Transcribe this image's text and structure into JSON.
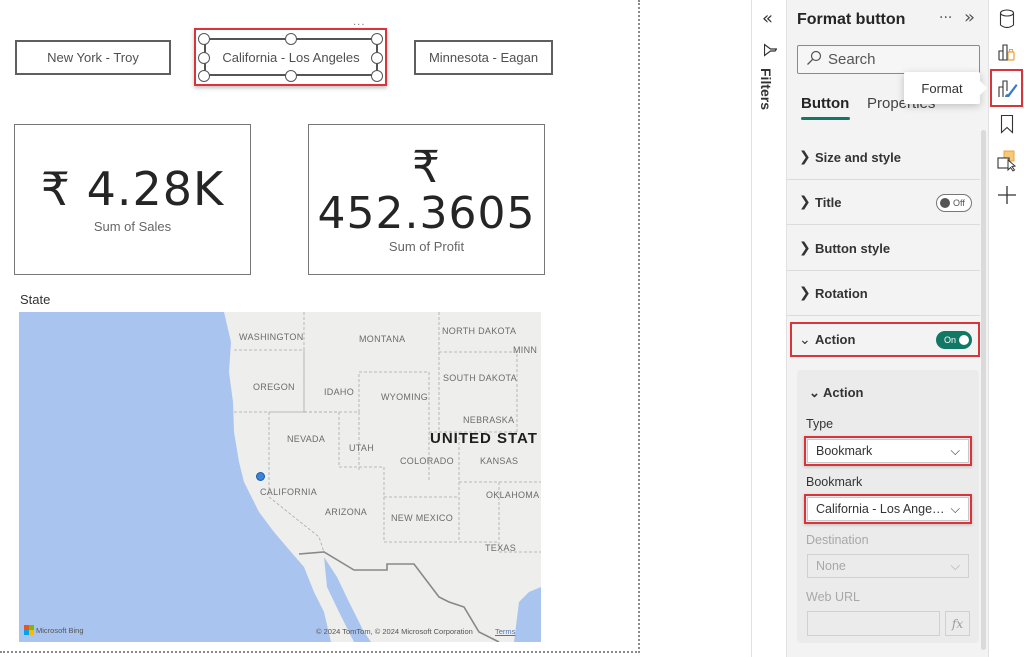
{
  "canvas": {
    "bookmark_buttons": [
      {
        "label": "New York - Troy",
        "selected": false
      },
      {
        "label": "California - Los Angeles",
        "selected": true
      },
      {
        "label": "Minnesota - Eagan",
        "selected": false
      }
    ],
    "more_options": "···",
    "cards": [
      {
        "value": "₹ 4.28K",
        "label": "Sum of Sales"
      },
      {
        "value_line1": "₹",
        "value_line2": "452.3605",
        "label": "Sum of Profit"
      }
    ],
    "map": {
      "title": "State",
      "labels": {
        "washington": "WASHINGTON",
        "montana": "MONTANA",
        "north_dakota": "NORTH DAKOTA",
        "minnesota": "MINN",
        "oregon": "OREGON",
        "idaho": "IDAHO",
        "wyoming": "WYOMING",
        "south_dakota": "SOUTH DAKOTA",
        "nebraska": "NEBRASKA",
        "nevada": "NEVADA",
        "utah": "UTAH",
        "colorado": "COLORADO",
        "kansas": "KANSAS",
        "california": "CALIFORNIA",
        "arizona": "ARIZONA",
        "new_mexico": "NEW MEXICO",
        "oklahoma": "OKLAHOMA",
        "texas": "TEXAS",
        "country": "UNITED STAT"
      },
      "attribution": "© 2024 TomTom, © 2024 Microsoft Corporation",
      "terms": "Terms",
      "provider": "Microsoft Bing",
      "water_color": "#a9c4ee",
      "land_color": "#eeeeec",
      "point_color": "#3a84d8"
    }
  },
  "filters": {
    "collapse_icon": "«",
    "label": "Filters"
  },
  "format_pane": {
    "title": "Format button",
    "more": "···",
    "expand_icon": "»",
    "search_placeholder": "Search",
    "tabs": [
      {
        "label": "Button",
        "active": true
      },
      {
        "label": "Properties",
        "active": false
      }
    ],
    "tooltip": "Format",
    "sections": [
      {
        "label": "Size and style",
        "expanded": false
      },
      {
        "label": "Title",
        "expanded": false,
        "toggle": "Off"
      },
      {
        "label": "Button style",
        "expanded": false
      },
      {
        "label": "Rotation",
        "expanded": false
      },
      {
        "label": "Action",
        "expanded": true,
        "toggle": "On"
      }
    ],
    "action_group": {
      "title": "Action",
      "type_label": "Type",
      "type_value": "Bookmark",
      "bookmark_label": "Bookmark",
      "bookmark_value": "California - Los Angeles",
      "destination_label": "Destination",
      "destination_value": "None",
      "web_url_label": "Web URL",
      "web_url_value": "",
      "fx_label": "fx"
    },
    "accent_color": "#117865",
    "highlight_color": "#d9343c"
  },
  "rail": {
    "icons": [
      "data-icon",
      "build-visual-icon",
      "format-visual-icon",
      "bookmark-icon",
      "selection-icon",
      "add-icon"
    ],
    "active": "format-visual-icon"
  }
}
